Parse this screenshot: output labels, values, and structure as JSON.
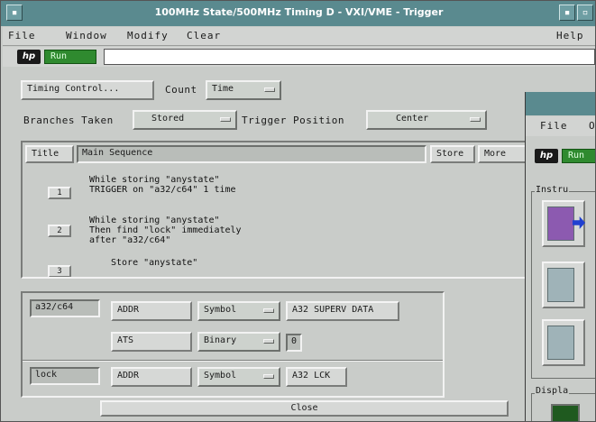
{
  "window": {
    "title": "100MHz State/500MHz Timing D - VXI/VME - Trigger",
    "close_glyph": "▫",
    "minimize_glyph": "▪"
  },
  "menubar": {
    "file": "File",
    "window": "Window",
    "modify": "Modify",
    "clear": "Clear",
    "help": "Help"
  },
  "status": {
    "logo": "hp",
    "run_label": "Run",
    "message": ""
  },
  "controls": {
    "timing_control_label": "Timing Control...",
    "count_label": "Count",
    "count_value": "Time",
    "branches_label": "Branches Taken",
    "branches_value": "Stored",
    "trigger_position_label": "Trigger Position",
    "trigger_position_value": "Center"
  },
  "sequence": {
    "title_label": "Title",
    "title_value": "Main Sequence",
    "store_button": "Store",
    "more_button": "More",
    "steps": [
      {
        "number": "1",
        "text": "While storing \"anystate\"\nTRIGGER on \"a32/c64\" 1 time"
      },
      {
        "number": "2",
        "text": "While storing \"anystate\"\nThen find \"lock\" immediately\nafter \"a32/c64\""
      },
      {
        "number": "3",
        "text": "Store \"anystate\""
      }
    ]
  },
  "terms": [
    {
      "name": "a32/c64",
      "label1": "ADDR",
      "format1": "Symbol",
      "value1": "A32 SUPERV DATA",
      "label2": "ATS",
      "format2": "Binary",
      "value2": "0"
    },
    {
      "name": "lock",
      "label1": "ADDR",
      "format1": "Symbol",
      "value1": "A32 LCK"
    }
  ],
  "close_button": "Close",
  "second_window": {
    "menu_file": "File",
    "menu_other": "O",
    "logo": "hp",
    "run_label": "Run",
    "instruments_label": "Instru",
    "display_label": "Displa"
  }
}
